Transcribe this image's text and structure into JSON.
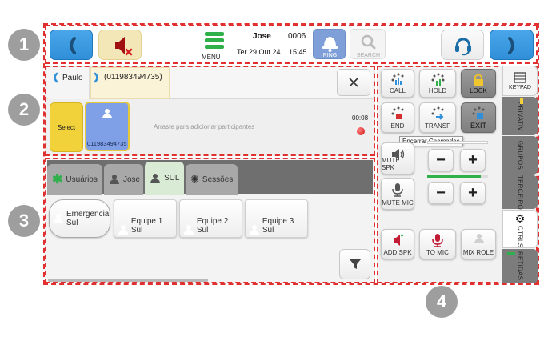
{
  "callouts": [
    "1",
    "2",
    "3",
    "4"
  ],
  "top_bar": {
    "menu_label": "MENU",
    "user_name": "Jose",
    "extension": "0006",
    "date": "Ter 29 Out 24",
    "time": "15:45",
    "ring_label": "RING",
    "search_label": "SEARCH"
  },
  "call_panel": {
    "tab_contact": "Paulo",
    "tab_number": "(011983494735)",
    "select_label": "Select",
    "participant_number": "011983494735",
    "drag_hint": "Arraste para adicionar participantes",
    "call_timer": "00:08"
  },
  "groups": {
    "tabs": [
      {
        "label": "Usuários",
        "icon": "asterisk-icon"
      },
      {
        "label": "Jose",
        "icon": "person-icon"
      },
      {
        "label": "SUL",
        "icon": "people-icon"
      },
      {
        "label": "Sessões",
        "icon": "gear-icon"
      }
    ],
    "items": [
      {
        "label_line1": "Emergencia",
        "label_line2": "Sul"
      },
      {
        "label": "Equipe 1 Sul"
      },
      {
        "label": "Equipe 2 Sul"
      },
      {
        "label": "Equipe 3 Sul"
      }
    ]
  },
  "controls": {
    "call": "CALL",
    "hold": "HOLD",
    "lock": "LOCK",
    "end": "END",
    "transf": "TRANSF",
    "exit": "EXIT",
    "tooltip": "Encerrar Chamadas",
    "mute_spk": "MUTE SPK",
    "mute_mic": "MUTE MIC",
    "minus": "−",
    "plus": "+",
    "add_spk": "ADD SPK",
    "to_mic": "TO MIC",
    "mix_role": "MIX ROLE"
  },
  "side_tabs": {
    "keypad": "KEYPAD",
    "privativ": "PRIVATIV",
    "grupos": "GRUPOS",
    "terceiro": "TERCEIRO",
    "ctrls": "CTRLS",
    "retidas": "RETIDAS"
  },
  "colors": {
    "accent_blue": "#2f8fd8",
    "dashed_border": "#e03030",
    "select_yellow": "#f2d23a",
    "participant_blue": "#7f9fe6",
    "menu_green": "#2fb04a",
    "end_red": "#d32f2f"
  }
}
